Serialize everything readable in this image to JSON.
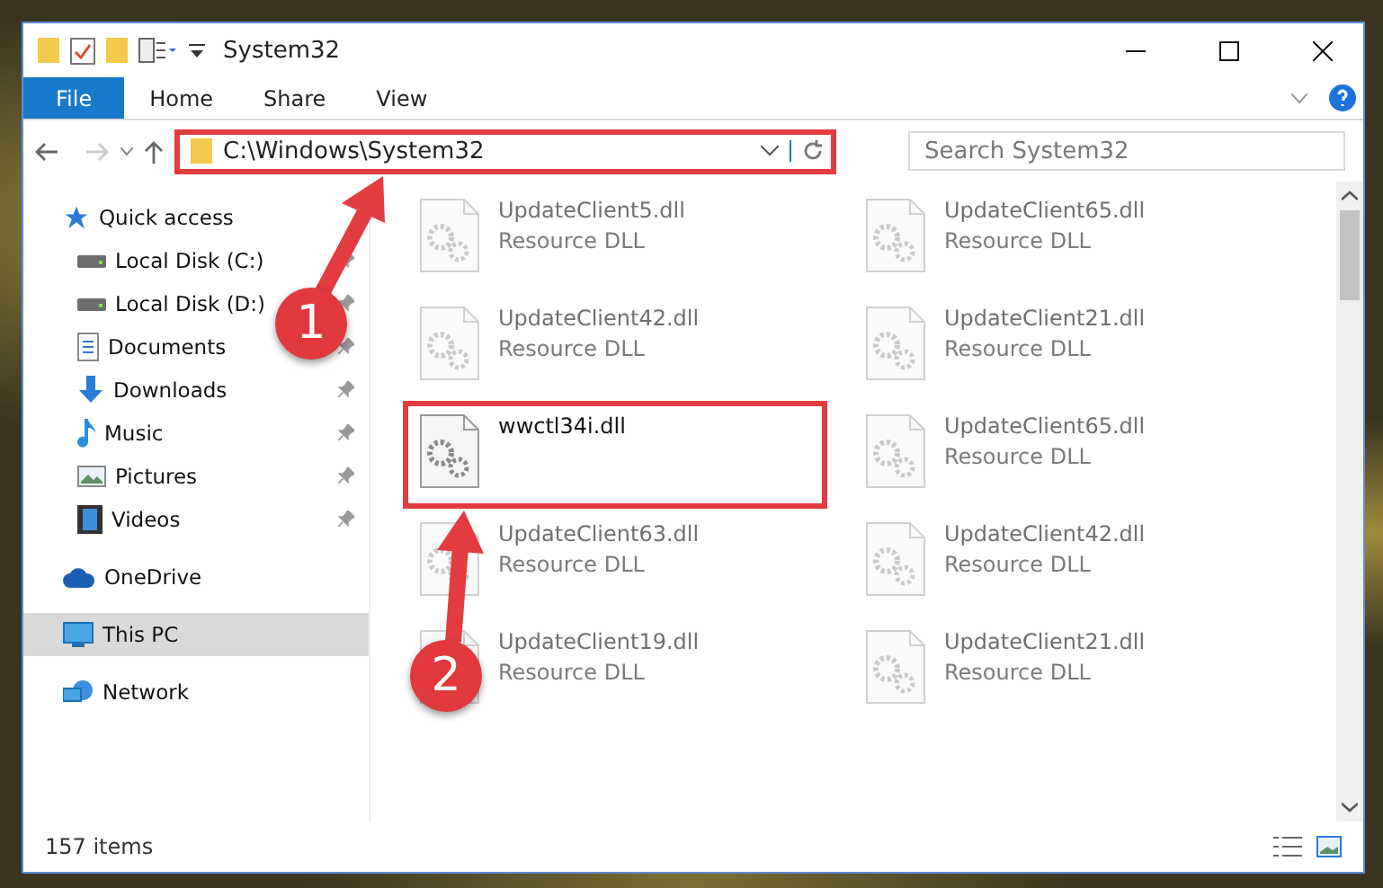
{
  "window": {
    "title": "System32"
  },
  "ribbon_tabs": [
    {
      "label": "File",
      "selected": true
    },
    {
      "label": "Home",
      "selected": false
    },
    {
      "label": "Share",
      "selected": false
    },
    {
      "label": "View",
      "selected": false
    }
  ],
  "address": {
    "value": "C:\\Windows\\System32",
    "highlighted": true
  },
  "search": {
    "placeholder": "Search System32"
  },
  "sidebar": {
    "items": [
      {
        "label": "Quick access",
        "kind": "star",
        "selected": false,
        "children": [
          {
            "label": "Local Disk (C:)",
            "kind": "disk",
            "pinned": true,
            "selected": false
          },
          {
            "label": "Local Disk (D:)",
            "kind": "disk",
            "pinned": true,
            "selected": false
          },
          {
            "label": "Documents",
            "kind": "doc",
            "pinned": true,
            "selected": false
          },
          {
            "label": "Downloads",
            "kind": "download",
            "pinned": true,
            "selected": false
          },
          {
            "label": "Music",
            "kind": "music",
            "pinned": true,
            "selected": false
          },
          {
            "label": "Pictures",
            "kind": "pictures",
            "pinned": true,
            "selected": false
          },
          {
            "label": "Videos",
            "kind": "videos",
            "pinned": true,
            "selected": false
          }
        ]
      },
      {
        "label": "OneDrive",
        "kind": "cloud",
        "selected": false
      },
      {
        "label": "This PC",
        "kind": "pc",
        "selected": true
      },
      {
        "label": "Network",
        "kind": "network",
        "selected": false
      }
    ]
  },
  "files": [
    {
      "name": "UpdateClient5.dll",
      "type": "Resource DLL",
      "blurred": true,
      "highlighted": false
    },
    {
      "name": "UpdateClient65.dll",
      "type": "Resource DLL",
      "blurred": true,
      "highlighted": false
    },
    {
      "name": "UpdateClient42.dll",
      "type": "Resource DLL",
      "blurred": true,
      "highlighted": false
    },
    {
      "name": "UpdateClient21.dll",
      "type": "Resource DLL",
      "blurred": true,
      "highlighted": false
    },
    {
      "name": "wwctl34i.dll",
      "blurred": false,
      "highlighted": true
    },
    {
      "name": "UpdateClient65.dll",
      "type": "Resource DLL",
      "blurred": true,
      "highlighted": false
    },
    {
      "name": "UpdateClient63.dll",
      "type": "Resource DLL",
      "blurred": true,
      "highlighted": false
    },
    {
      "name": "UpdateClient42.dll",
      "type": "Resource DLL",
      "blurred": true,
      "highlighted": false
    },
    {
      "name": "UpdateClient19.dll",
      "type": "Resource DLL",
      "blurred": true,
      "highlighted": false
    },
    {
      "name": "UpdateClient21.dll",
      "type": "Resource DLL",
      "blurred": true,
      "highlighted": false
    }
  ],
  "annotations": [
    {
      "label": "1"
    },
    {
      "label": "2"
    }
  ],
  "status_bar": {
    "count": "157 items"
  }
}
